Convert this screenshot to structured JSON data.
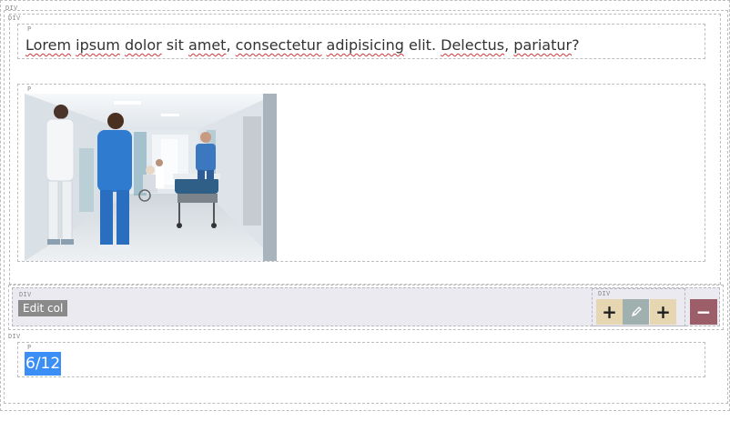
{
  "tags": {
    "div": "DIV",
    "p": "P"
  },
  "content": {
    "paragraph": {
      "words": [
        {
          "text": "Lorem",
          "spell": true
        },
        {
          "text": " ",
          "spell": false
        },
        {
          "text": "ipsum",
          "spell": true
        },
        {
          "text": " ",
          "spell": false
        },
        {
          "text": "dolor",
          "spell": true
        },
        {
          "text": " sit ",
          "spell": false
        },
        {
          "text": "amet",
          "spell": true
        },
        {
          "text": ", ",
          "spell": false
        },
        {
          "text": "consectetur",
          "spell": true
        },
        {
          "text": " ",
          "spell": false
        },
        {
          "text": "adipisicing",
          "spell": true
        },
        {
          "text": " elit. ",
          "spell": false
        },
        {
          "text": "Delectus",
          "spell": true
        },
        {
          "text": ", ",
          "spell": false
        },
        {
          "text": "pariatur",
          "spell": true
        },
        {
          "text": "?",
          "spell": false
        }
      ]
    }
  },
  "toolbar": {
    "edit_col_label": "Edit col",
    "add_before_icon": "plus-icon",
    "edit_icon": "pencil-icon",
    "add_after_icon": "plus-icon",
    "remove_icon": "minus-icon",
    "add_glyph": "+",
    "remove_glyph": "−",
    "colors": {
      "add": "#e6d7b2",
      "edit": "#9fb0ae",
      "remove": "#9c5f69",
      "bar": "#ebeaf0"
    }
  },
  "column": {
    "width_label": "6/12"
  },
  "colors": {
    "selection": "#3a8ef6",
    "spellcheck": "#d0353a"
  }
}
